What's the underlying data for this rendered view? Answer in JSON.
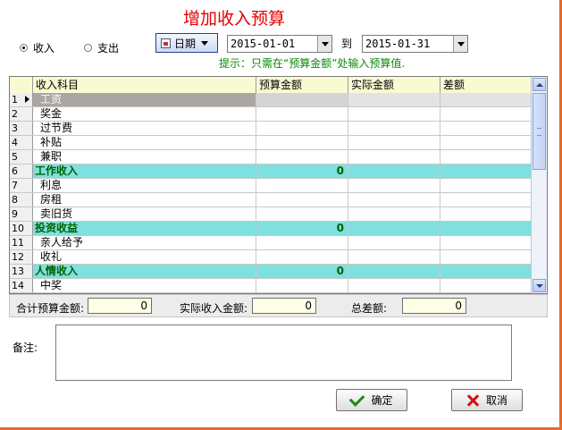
{
  "window": {
    "title": "增加收入预算"
  },
  "type_selector": {
    "income_label": "收入",
    "expense_label": "支出",
    "selected": "income"
  },
  "date_filter": {
    "mode_label": "日期",
    "start": "2015-01-01",
    "to_label": "到",
    "end": "2015-01-31"
  },
  "hint": "提示：只需在“预算金额”处输入预算值.",
  "grid": {
    "columns": [
      "收入科目",
      "预算金额",
      "实际金额",
      "差额"
    ],
    "rows": [
      {
        "no": "1",
        "item": "工资",
        "budget": "",
        "actual": "",
        "diff": "",
        "type": "item",
        "current": true
      },
      {
        "no": "2",
        "item": "奖金",
        "budget": "",
        "actual": "",
        "diff": "",
        "type": "item"
      },
      {
        "no": "3",
        "item": "过节费",
        "budget": "",
        "actual": "",
        "diff": "",
        "type": "item"
      },
      {
        "no": "4",
        "item": "补贴",
        "budget": "",
        "actual": "",
        "diff": "",
        "type": "item"
      },
      {
        "no": "5",
        "item": "兼职",
        "budget": "",
        "actual": "",
        "diff": "",
        "type": "item"
      },
      {
        "no": "6",
        "item": "工作收入",
        "budget": "0",
        "actual": "",
        "diff": "",
        "type": "subtotal"
      },
      {
        "no": "7",
        "item": "利息",
        "budget": "",
        "actual": "",
        "diff": "",
        "type": "item"
      },
      {
        "no": "8",
        "item": "房租",
        "budget": "",
        "actual": "",
        "diff": "",
        "type": "item"
      },
      {
        "no": "9",
        "item": "卖旧货",
        "budget": "",
        "actual": "",
        "diff": "",
        "type": "item"
      },
      {
        "no": "10",
        "item": "投资收益",
        "budget": "0",
        "actual": "",
        "diff": "",
        "type": "subtotal"
      },
      {
        "no": "11",
        "item": "亲人给予",
        "budget": "",
        "actual": "",
        "diff": "",
        "type": "item"
      },
      {
        "no": "12",
        "item": "收礼",
        "budget": "",
        "actual": "",
        "diff": "",
        "type": "item"
      },
      {
        "no": "13",
        "item": "人情收入",
        "budget": "0",
        "actual": "",
        "diff": "",
        "type": "subtotal"
      },
      {
        "no": "14",
        "item": "中奖",
        "budget": "",
        "actual": "",
        "diff": "",
        "type": "item"
      }
    ]
  },
  "totals": {
    "budget_label": "合计预算金额:",
    "budget_value": "0",
    "actual_label": "实际收入金额:",
    "actual_value": "0",
    "diff_label": "总差额:",
    "diff_value": "0"
  },
  "note": {
    "label": "备注:",
    "value": ""
  },
  "buttons": {
    "ok": "确定",
    "cancel": "取消"
  },
  "colors": {
    "title": "#e60000",
    "hint": "#0a8a0a",
    "subtotal_row": "#7fe0e0",
    "header": "#fafad2",
    "frame": "#e86b2a"
  }
}
